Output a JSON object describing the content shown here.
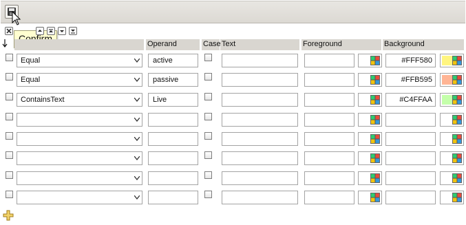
{
  "toolbar": {
    "save_tooltip": "Confirm"
  },
  "icons": {
    "save": "floppy-disk-icon",
    "remove": "close-icon",
    "move_up": "move-up-icon",
    "move_down": "move-down-icon",
    "move_bottom": "move-bottom-icon",
    "add": "plus-icon",
    "sort": "sort-arrow-icon",
    "dropdown": "chevron-down-icon",
    "palette": "color-palette-icon"
  },
  "columns": {
    "condition": "",
    "operand": "Operand",
    "case": "Case",
    "text": "Text",
    "foreground": "Foreground",
    "background": "Background"
  },
  "rows": [
    {
      "condition": "Equal",
      "operand": "active",
      "text": "",
      "foreground": "",
      "background": "#FFF580",
      "bg_color": "#FFF580"
    },
    {
      "condition": "Equal",
      "operand": "passive",
      "text": "",
      "foreground": "",
      "background": "#FFB595",
      "bg_color": "#FFB595"
    },
    {
      "condition": "ContainsText",
      "operand": "Live",
      "text": "",
      "foreground": "",
      "background": "#C4FFAA",
      "bg_color": "#C4FFAA"
    },
    {
      "condition": "",
      "operand": "",
      "text": "",
      "foreground": "",
      "background": "",
      "bg_color": "#FFFFFF"
    },
    {
      "condition": "",
      "operand": "",
      "text": "",
      "foreground": "",
      "background": "",
      "bg_color": "#FFFFFF"
    },
    {
      "condition": "",
      "operand": "",
      "text": "",
      "foreground": "",
      "background": "",
      "bg_color": "#FFFFFF"
    },
    {
      "condition": "",
      "operand": "",
      "text": "",
      "foreground": "",
      "background": "",
      "bg_color": "#FFFFFF"
    },
    {
      "condition": "",
      "operand": "",
      "text": "",
      "foreground": "",
      "background": "",
      "bg_color": "#FFFFFF"
    }
  ]
}
